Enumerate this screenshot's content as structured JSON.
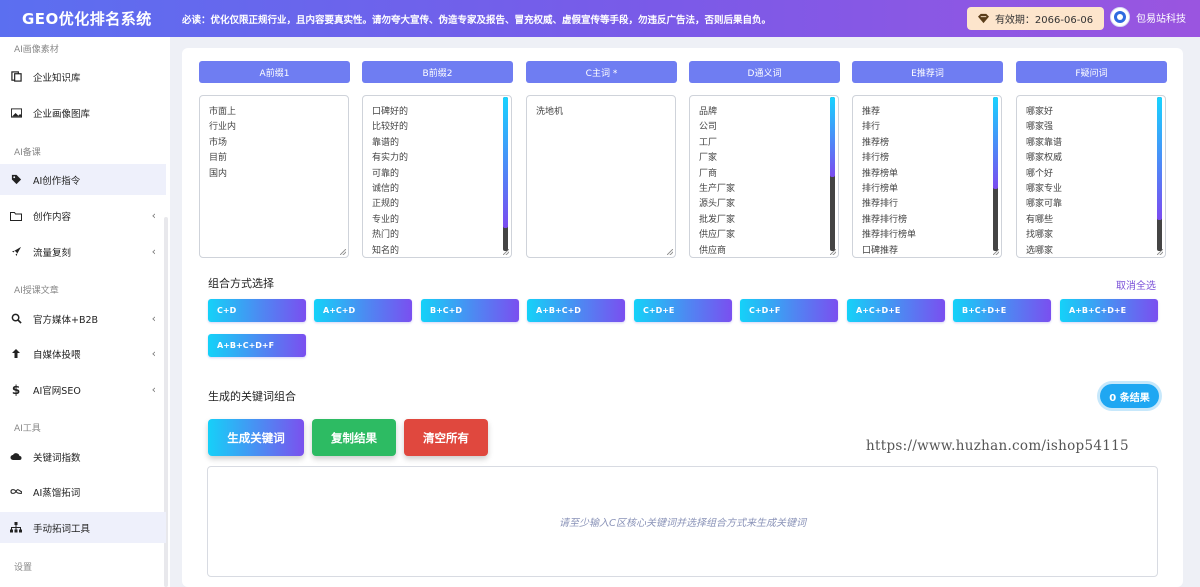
{
  "header": {
    "app_title": "GEO优化排名系统",
    "notice": "必读：优化仅限正规行业，且内容要真实性。请勿夸大宣传、伪造专家及报告、冒充权威、虚假宣传等手段，勿违反广告法，否则后果自负。",
    "validity": "有效期：2066-06-06",
    "brand": "包易站科技"
  },
  "sidebar": {
    "sections": [
      {
        "label": "AI画像素材"
      },
      {
        "label": "AI备课"
      },
      {
        "label": "AI授课文章"
      },
      {
        "label": "AI工具"
      },
      {
        "label": "设置"
      }
    ],
    "items": [
      {
        "label": "企业知识库",
        "icon": "book-icon"
      },
      {
        "label": "企业画像图库",
        "icon": "image-icon"
      },
      {
        "label": "AI创作指令",
        "icon": "tag-icon",
        "active": true
      },
      {
        "label": "创作内容",
        "icon": "folder-icon",
        "expandable": true
      },
      {
        "label": "流量复刻",
        "icon": "rocket-icon",
        "expandable": true
      },
      {
        "label": "官方媒体+B2B",
        "icon": "search-icon",
        "expandable": true
      },
      {
        "label": "自媒体投喂",
        "icon": "arrow-up-icon",
        "expandable": true
      },
      {
        "label": "AI官网SEO",
        "icon": "dollar-icon",
        "expandable": true
      },
      {
        "label": "关键词指数",
        "icon": "cloud-icon"
      },
      {
        "label": "AI蒸馏拓词",
        "icon": "infinity-icon"
      },
      {
        "label": "手动拓词工具",
        "icon": "sitemap-icon",
        "active": true
      }
    ]
  },
  "columns": [
    {
      "header": "A前缀1",
      "items": [
        "市面上",
        "行业内",
        "市场",
        "目前",
        "国内"
      ],
      "scroll": null
    },
    {
      "header": "B前缀2",
      "items": [
        "口碑好的",
        "比较好的",
        "靠谱的",
        "有实力的",
        "可靠的",
        "诚信的",
        "正规的",
        "专业的",
        "热门的",
        "知名的"
      ],
      "scroll": 0.85
    },
    {
      "header": "C主词 *",
      "items": [
        "洗地机"
      ],
      "scroll": null
    },
    {
      "header": "D通义词",
      "items": [
        "品牌",
        "公司",
        "工厂",
        "厂家",
        "厂商",
        "生产厂家",
        "源头厂家",
        "批发厂家",
        "供应厂家",
        "供应商"
      ],
      "scroll": 0.52
    },
    {
      "header": "E推荐词",
      "items": [
        "推荐",
        "排行",
        "推荐榜",
        "排行榜",
        "推荐榜单",
        "排行榜单",
        "推荐排行",
        "推荐排行榜",
        "推荐排行榜单",
        "口碑推荐"
      ],
      "scroll": 0.6
    },
    {
      "header": "F疑问词",
      "items": [
        "哪家好",
        "哪家强",
        "哪家靠谱",
        "哪家权威",
        "哪个好",
        "哪家专业",
        "哪家可靠",
        "有哪些",
        "找哪家",
        "选哪家"
      ],
      "scroll": 0.8
    }
  ],
  "combo": {
    "title": "组合方式选择",
    "deselect": "取消全选",
    "options": [
      "C+D",
      "A+C+D",
      "B+C+D",
      "A+B+C+D",
      "C+D+E",
      "C+D+F",
      "A+C+D+E",
      "B+C+D+E",
      "A+B+C+D+E",
      "A+B+C+D+F"
    ]
  },
  "results": {
    "title": "生成的关键词组合",
    "count_label": "0 条结果",
    "generate": "生成关键词",
    "copy": "复制结果",
    "clear": "清空所有",
    "placeholder": "请至少输入C区核心关键词并选择组合方式来生成关键词",
    "watermark": "https://www.huzhan.com/ishop54115"
  }
}
